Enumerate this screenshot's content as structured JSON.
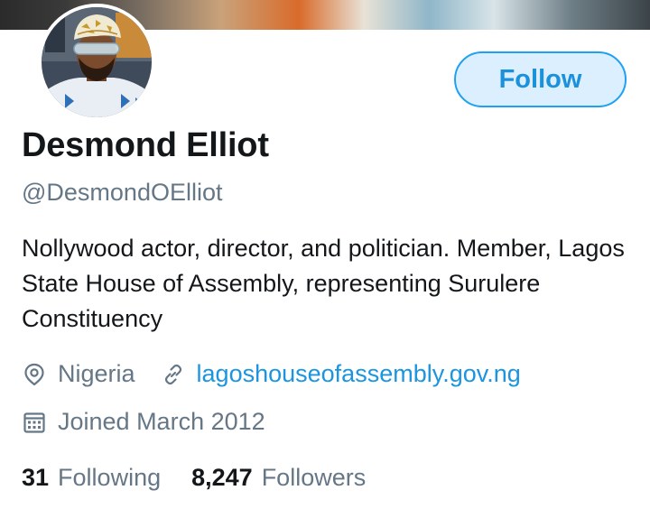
{
  "profile": {
    "display_name": "Desmond Elliot",
    "handle": "@DesmondOElliot",
    "bio": "Nollywood actor, director, and politician. Member, Lagos State House of Assembly, representing Surulere Constituency",
    "location": "Nigeria",
    "website": "lagoshouseofassembly.gov.ng",
    "joined": "Joined March 2012"
  },
  "actions": {
    "follow_label": "Follow"
  },
  "stats": {
    "following_count": "31",
    "following_label": "Following",
    "followers_count": "8,247",
    "followers_label": "Followers"
  },
  "icons": {
    "location": "map-pin-icon",
    "website": "link-icon",
    "joined": "calendar-icon"
  },
  "colors": {
    "accent": "#1da1f2",
    "link": "#1b95e0",
    "secondary_text": "#657786",
    "primary_text": "#14171a",
    "follow_bg": "#dcefff"
  }
}
